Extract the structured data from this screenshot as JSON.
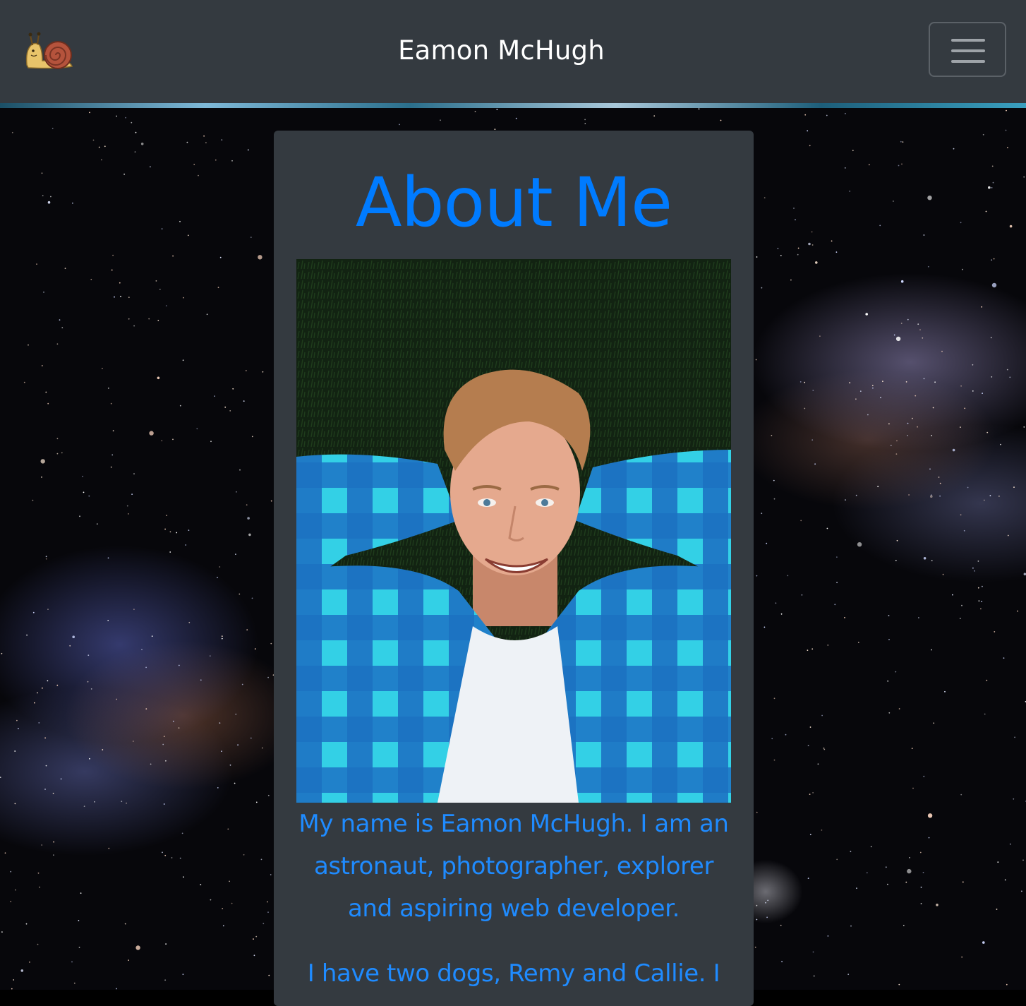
{
  "navbar": {
    "brand_title": "Eamon McHugh",
    "logo_icon": "snail-icon",
    "toggler_icon": "hamburger-menu-icon"
  },
  "about": {
    "title": "About Me",
    "paragraphs": [
      "My name is Eamon McHugh. I am an astronaut, photographer, explorer and aspiring web developer.",
      "I have two dogs, Remy and Callie. I"
    ]
  },
  "colors": {
    "navbar_bg": "#343a40",
    "card_bg": "#343a40",
    "accent_blue": "#007bff",
    "text_white": "#ffffff"
  }
}
